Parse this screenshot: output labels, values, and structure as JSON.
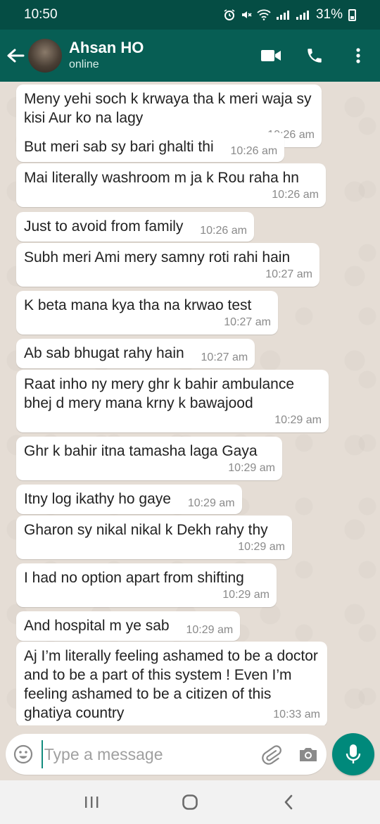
{
  "status_bar": {
    "time": "10:50",
    "icons": [
      "alarm-icon",
      "mute-icon",
      "wifi-icon",
      "signal-icon",
      "signal-icon"
    ],
    "battery": "31%"
  },
  "header": {
    "contact_name": "Ahsan HO",
    "contact_status": "online"
  },
  "messages": [
    {
      "text": "Meny yehi soch k krwaya tha k meri waja sy kisi Aur ko na lagy",
      "time": "10:26 am"
    },
    {
      "text": "But meri sab sy bari ghalti thi",
      "time": "10:26 am"
    },
    {
      "text": "Mai literally washroom m ja k Rou raha hn",
      "time": "10:26 am"
    },
    {
      "text": "Just to avoid from family",
      "time": "10:26 am"
    },
    {
      "text": "Subh meri Ami mery samny roti rahi hain",
      "time": "10:27 am"
    },
    {
      "text": "K beta mana kya tha na krwao test",
      "time": "10:27 am"
    },
    {
      "text": "Ab sab bhugat rahy hain",
      "time": "10:27 am"
    },
    {
      "text": "Raat inho ny mery ghr k bahir ambulance bhej d mery mana krny k bawajood",
      "time": "10:29 am"
    },
    {
      "text": "Ghr k bahir itna tamasha laga Gaya",
      "time": "10:29 am"
    },
    {
      "text": "Itny log ikathy ho gaye",
      "time": "10:29 am"
    },
    {
      "text": "Gharon sy nikal nikal k Dekh rahy thy",
      "time": "10:29 am"
    },
    {
      "text": "I had no option apart from shifting",
      "time": "10:29 am"
    },
    {
      "text": "And hospital m ye sab",
      "time": "10:29 am"
    },
    {
      "text": "Aj I’m literally feeling ashamed to be a doctor and to be a part of this system ! Even I’m feeling ashamed to be a citizen of this ghatiya country",
      "time": "10:33 am"
    }
  ],
  "input": {
    "placeholder": "Type a message"
  },
  "colors": {
    "header": "#075e54",
    "status_bar": "#054d44",
    "accent": "#00897b",
    "chat_bg": "#e5ddd5",
    "bubble": "#ffffff"
  }
}
